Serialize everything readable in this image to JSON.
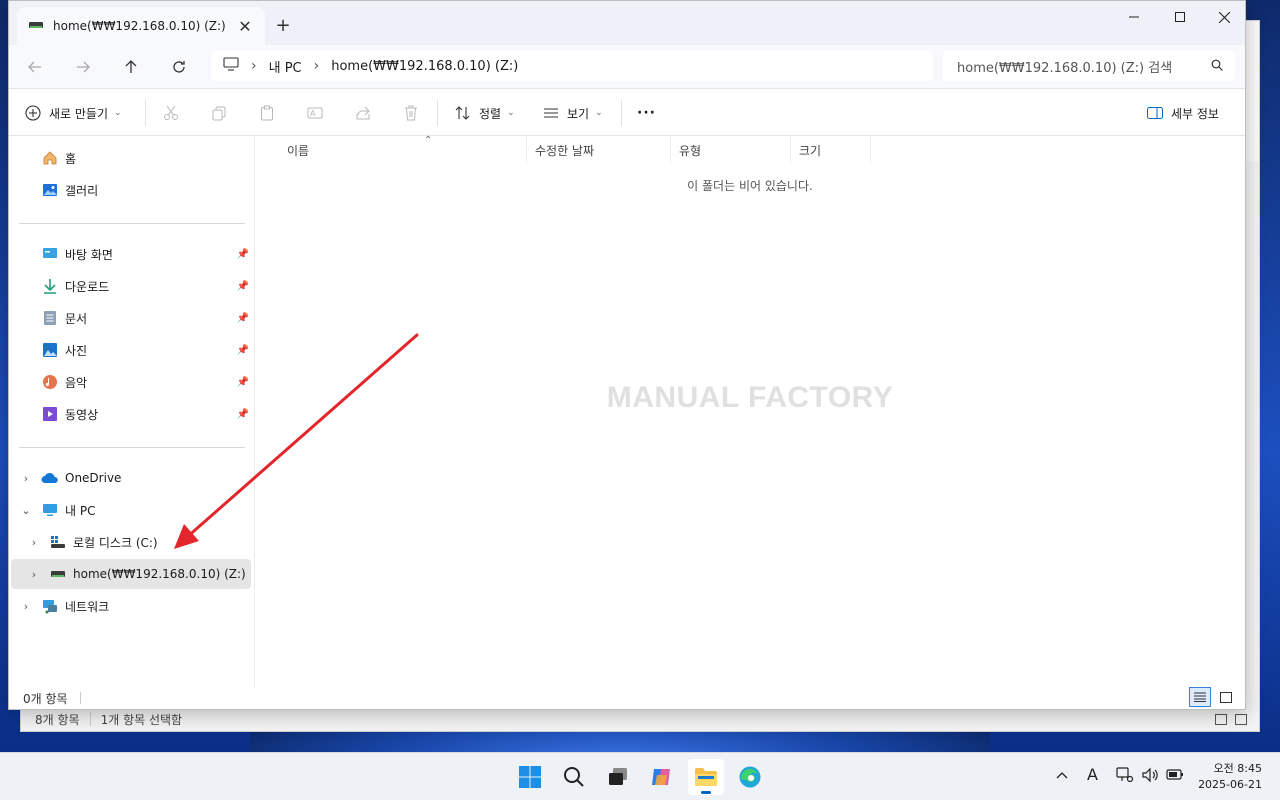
{
  "window": {
    "tab_title": "home(₩₩192.168.0.10) (Z:)",
    "new_tab": "+",
    "close_tab": "✕"
  },
  "address": {
    "crumb_root": "내 PC",
    "crumb_current": "home(₩₩192.168.0.10) (Z:)",
    "search_placeholder": "home(₩₩192.168.0.10) (Z:) 검색"
  },
  "toolbar": {
    "new_label": "새로 만들기",
    "sort_label": "정렬",
    "view_label": "보기",
    "more_label": "···",
    "details_label": "세부 정보"
  },
  "sidebar": {
    "quick": [
      {
        "label": "홈"
      },
      {
        "label": "갤러리"
      }
    ],
    "pinned": [
      {
        "label": "바탕 화면"
      },
      {
        "label": "다운로드"
      },
      {
        "label": "문서"
      },
      {
        "label": "사진"
      },
      {
        "label": "음악"
      },
      {
        "label": "동영상"
      }
    ],
    "tree": {
      "onedrive": "OneDrive",
      "this_pc": "내 PC",
      "local_disk": "로컬 디스크 (C:)",
      "network_drive": "home(₩₩192.168.0.10) (Z:)",
      "network": "네트워크"
    }
  },
  "columns": [
    "이름",
    "수정한 날짜",
    "유형",
    "크기"
  ],
  "content": {
    "empty_message": "이 폴더는 비어 있습니다.",
    "watermark": "MANUAL FACTORY"
  },
  "status": {
    "item_count": "0개 항목"
  },
  "background_window": {
    "item_count": "8개 항목",
    "selected": "1개 항목 선택함"
  },
  "taskbar": {
    "ime": "A",
    "time": "오전 8:45",
    "date": "2025-06-21"
  },
  "colors": {
    "accent": "#0067c0",
    "annotation_arrow": "#e3262b",
    "selected_bg": "#e5e5e5"
  }
}
